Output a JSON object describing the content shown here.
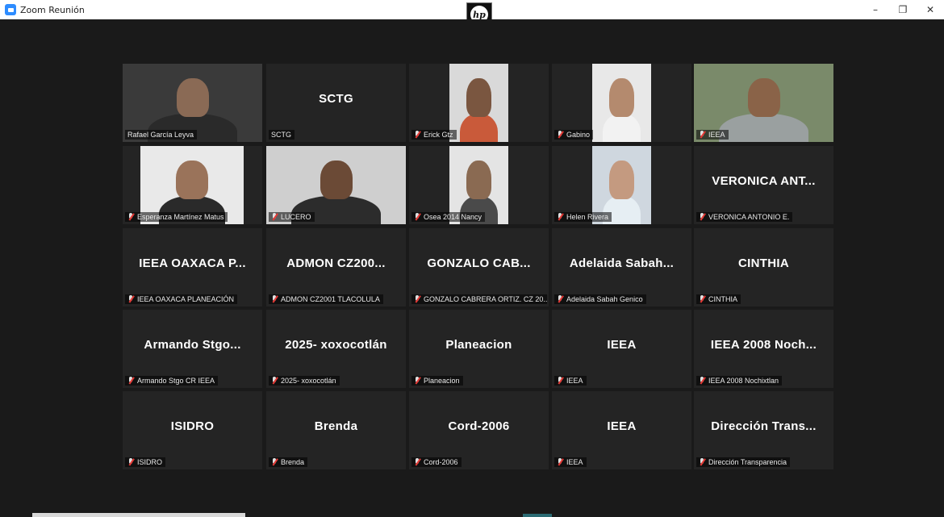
{
  "window": {
    "title": "Zoom Reunión",
    "brand_logo": "hp",
    "controls": [
      "–",
      "❐",
      "✕"
    ]
  },
  "colors": {
    "active_speaker_border": "#c6e05a",
    "tile_bg": "#242424",
    "stage_bg": "#1a1a1a",
    "muted_mic": "#e53935"
  },
  "tiles": [
    {
      "display": "",
      "label": "Rafael García Leyva",
      "video": true,
      "muted": false,
      "active": true,
      "icon": "video-feed"
    },
    {
      "display": "SCTG",
      "label": "SCTG",
      "video": false,
      "muted": false
    },
    {
      "display": "",
      "label": "Erick Gtz",
      "video": true,
      "muted": true
    },
    {
      "display": "",
      "label": "Gabino",
      "video": true,
      "muted": true
    },
    {
      "display": "",
      "label": "IEEA",
      "video": true,
      "muted": true
    },
    {
      "display": "",
      "label": "Esperanza Martínez Matus",
      "video": true,
      "muted": true
    },
    {
      "display": "",
      "label": "LUCERO",
      "video": true,
      "muted": true
    },
    {
      "display": "",
      "label": "Osea 2014 Nancy",
      "video": true,
      "muted": true
    },
    {
      "display": "",
      "label": "Helen Rivera",
      "video": true,
      "muted": true
    },
    {
      "display": "VERONICA ANT...",
      "label": "VERONICA ANTONIO E.",
      "video": false,
      "muted": true
    },
    {
      "display": "IEEA OAXACA P...",
      "label": "IEEA OAXACA PLANEACIÓN",
      "video": false,
      "muted": true
    },
    {
      "display": "ADMON CZ200...",
      "label": "ADMON CZ2001 TLACOLULA",
      "video": false,
      "muted": true
    },
    {
      "display": "GONZALO CAB...",
      "label": "GONZALO CABRERA ORTIZ. CZ 20...",
      "video": false,
      "muted": true
    },
    {
      "display": "Adelaida Sabah...",
      "label": "Adelaida Sabah Genico",
      "video": false,
      "muted": true
    },
    {
      "display": "CINTHIA",
      "label": "CINTHIA",
      "video": false,
      "muted": true
    },
    {
      "display": "Armando Stgo...",
      "label": "Armando Stgo CR IEEA",
      "video": false,
      "muted": true
    },
    {
      "display": "2025- xoxocotlán",
      "label": "2025- xoxocotlán",
      "video": false,
      "muted": true
    },
    {
      "display": "Planeacion",
      "label": "Planeacion",
      "video": false,
      "muted": true
    },
    {
      "display": "IEEA",
      "label": "IEEA",
      "video": false,
      "muted": true
    },
    {
      "display": "IEEA 2008 Noch...",
      "label": "IEEA 2008 Nochixtlan",
      "video": false,
      "muted": true
    },
    {
      "display": "ISIDRO",
      "label": "ISIDRO",
      "video": false,
      "muted": true
    },
    {
      "display": "Brenda",
      "label": "Brenda",
      "video": false,
      "muted": true
    },
    {
      "display": "Cord-2006",
      "label": "Cord-2006",
      "video": false,
      "muted": true
    },
    {
      "display": "IEEA",
      "label": "IEEA",
      "video": false,
      "muted": true
    },
    {
      "display": "Dirección Trans...",
      "label": "Dirección Transparencia",
      "video": false,
      "muted": true
    }
  ]
}
